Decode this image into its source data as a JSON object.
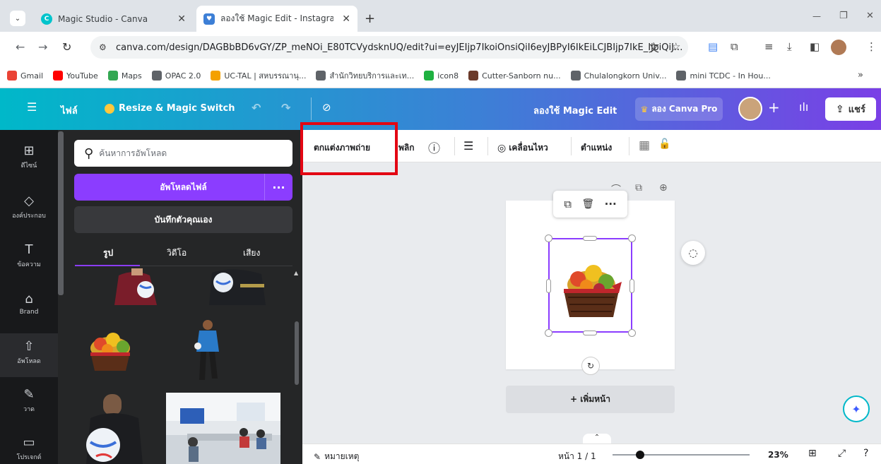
{
  "browser": {
    "tabs": [
      {
        "title": "Magic Studio - Canva",
        "active": false
      },
      {
        "title": "ลองใช้ Magic Edit - Instagram โพ",
        "active": true
      }
    ],
    "new_tab": "+",
    "window_controls": {
      "minimize": "—",
      "restore": "❐",
      "close": "✕"
    },
    "url": "canva.com/design/DAGBbBD6vGY/ZP_meNOi_E80TCVydsknUQ/edit?ui=eyJEIjp7IkoiOnsiQiI6eyJBPyI6IkEiLCJBIjp7IkE_IjoiQiJ...",
    "bookmarks": [
      {
        "label": "Gmail",
        "icon": "gmail-icon",
        "color": "#ea4335"
      },
      {
        "label": "YouTube",
        "icon": "youtube-icon",
        "color": "#ff0000"
      },
      {
        "label": "Maps",
        "icon": "maps-icon",
        "color": "#34a853"
      },
      {
        "label": "OPAC 2.0",
        "icon": "globe-icon",
        "color": "#5f6368"
      },
      {
        "label": "UC-TAL | สหบรรณานุ...",
        "icon": "uc-icon",
        "color": "#f4a100"
      },
      {
        "label": "สำนักวิทยบริการและเท...",
        "icon": "globe-icon",
        "color": "#5f6368"
      },
      {
        "label": "icon8",
        "icon": "icon8-icon",
        "color": "#1fb141"
      },
      {
        "label": "Cutter-Sanborn nu...",
        "icon": "cutter-icon",
        "color": "#6b3a2a"
      },
      {
        "label": "Chulalongkorn Univ...",
        "icon": "globe-icon",
        "color": "#5f6368"
      },
      {
        "label": "mini TCDC - In Hou...",
        "icon": "globe-icon",
        "color": "#5f6368"
      }
    ],
    "bookmarks_more": "»"
  },
  "header": {
    "menu_icon": "☰",
    "file": "ไฟล์",
    "resize": "Resize & Magic Switch",
    "try_magic_edit": "ลองใช้ Magic Edit",
    "try_pro": "ลอง Canva Pro",
    "plus": "+",
    "share": "แชร์",
    "colors": {
      "gradient_start": "#00b8c9",
      "gradient_end": "#7a3fe6",
      "pro_crown": "#ffc83d"
    }
  },
  "rail": [
    {
      "label": "ดีไซน์",
      "icon": "design-icon",
      "glyph": "⊞"
    },
    {
      "label": "องค์ประกอบ",
      "icon": "elements-icon",
      "glyph": "◇"
    },
    {
      "label": "ข้อความ",
      "icon": "text-icon",
      "glyph": "T"
    },
    {
      "label": "Brand",
      "icon": "brand-icon",
      "glyph": "⌂"
    },
    {
      "label": "อัพโหลด",
      "icon": "upload-icon",
      "glyph": "⇧"
    },
    {
      "label": "วาด",
      "icon": "draw-icon",
      "glyph": "✎"
    },
    {
      "label": "โปรเจกต์",
      "icon": "folder-icon",
      "glyph": "▭"
    }
  ],
  "panel": {
    "search_placeholder": "ค้นหาการอัพโหลด",
    "upload_button": "อัพโหลดไฟล์",
    "upload_more": "···",
    "record_button": "บันทึกตัวคุณเอง",
    "tabs": [
      "รูป",
      "วิดีโอ",
      "เสียง"
    ]
  },
  "context_toolbar": {
    "edit_photo": "ตกแต่งภาพถ่าย",
    "flip": "พลิก",
    "info_icon": "ⓘ",
    "lines_icon": "☰",
    "animate": "เคลื่อนไหว",
    "position": "ตำแหน่ง",
    "transparency_icon": "▦",
    "lock_icon": "🔓"
  },
  "canvas": {
    "element_toolbar": [
      "⧉",
      "🗑",
      "···"
    ],
    "page_icons": [
      "🔒",
      "⧉",
      "⊕"
    ],
    "rotate_icon": "↻",
    "side_icon": "💬",
    "add_page": "+ เพิ่มหน้า"
  },
  "footer": {
    "notes": "หมายเหตุ",
    "page": "หน้า 1 / 1",
    "zoom_percent": "23%",
    "zoom_level": 0.2
  },
  "colors": {
    "canva_purple": "#8b3dff",
    "highlight_red": "#e30613"
  }
}
